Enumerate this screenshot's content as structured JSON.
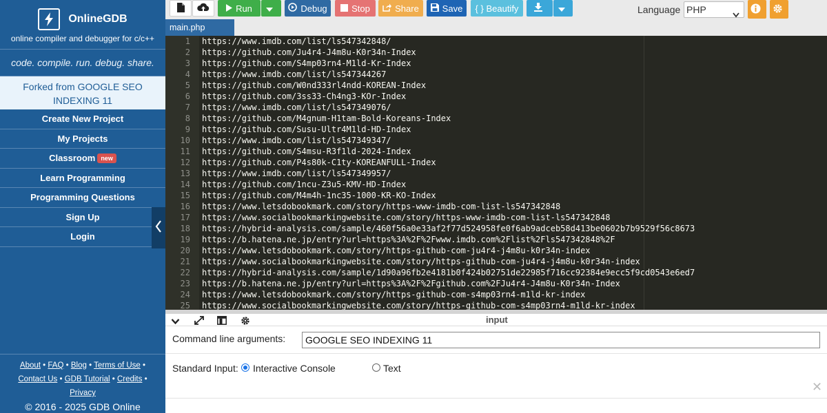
{
  "brand": {
    "name": "OnlineGDB",
    "tagline": "online compiler and debugger for c/c++"
  },
  "motto": "code. compile. run. debug. share.",
  "forked_from": "Forked from GOOGLE SEO INDEXING 11",
  "nav": [
    {
      "label": "Create New Project"
    },
    {
      "label": "My Projects"
    },
    {
      "label": "Classroom",
      "badge": "new"
    },
    {
      "label": "Learn Programming"
    },
    {
      "label": "Programming Questions"
    },
    {
      "label": "Sign Up"
    },
    {
      "label": "Login"
    }
  ],
  "footer": {
    "links": [
      "About",
      "FAQ",
      "Blog",
      "Terms of Use",
      "Contact Us",
      "GDB Tutorial",
      "Credits",
      "Privacy"
    ],
    "copyright": "© 2016 - 2025 GDB Online"
  },
  "toolbar": {
    "run": "Run",
    "debug": "Debug",
    "stop": "Stop",
    "share": "Share",
    "save": "Save",
    "beautify": "{ } Beautify",
    "language_label": "Language",
    "language_value": "PHP"
  },
  "colors": {
    "sidebar": "#1f5d96",
    "run": "#3fae49",
    "debug": "#2f6aa3",
    "stop": "#e57373",
    "share": "#f0ad4e",
    "save": "#1e64b4",
    "beautify": "#5bc0de",
    "download": "#3ba7d9",
    "orange": "#f0a030"
  },
  "editor": {
    "tab": "main.php",
    "lines": [
      "https://www.imdb.com/list/ls547342848/",
      "https://github.com/Ju4r4-J4m8u-K0r34n-Index",
      "https://github.com/S4mp03rn4-M1ld-Kr-Index",
      "https://www.imdb.com/list/ls547344267",
      "https://github.com/W0nd333rl4ndd-KOREAN-Index",
      "https://github.com/3ss33-Ch4ng3-KOr-Index",
      "https://www.imdb.com/list/ls547349076/",
      "https://github.com/M4gnum-H1tam-Bold-Koreans-Index",
      "https://github.com/Susu-Ultr4M1ld-HD-Index",
      "https://www.imdb.com/list/ls547349347/",
      "https://github.com/S4msu-R3f1ld-2024-Index",
      "https://github.com/P4s80k-C1ty-KOREANFULL-Index",
      "https://www.imdb.com/list/ls547349957/",
      "https://github.com/1ncu-Z3u5-KMV-HD-Index",
      "https://github.com/M4m4h-1nc35-1000-KR-KO-Index",
      "https://www.letsdobookmark.com/story/https-www-imdb-com-list-ls547342848",
      "https://www.socialbookmarkingwebsite.com/story/https-www-imdb-com-list-ls547342848",
      "https://hybrid-analysis.com/sample/460f56a0e33af2f77d524958fe0f6ab9adceb58d413be0602b7b9529f56c8673",
      "https://b.hatena.ne.jp/entry?url=https%3A%2F%2Fwww.imdb.com%2Flist%2Fls547342848%2F",
      "https://www.letsdobookmark.com/story/https-github-com-ju4r4-j4m8u-k0r34n-index",
      "https://www.socialbookmarkingwebsite.com/story/https-github-com-ju4r4-j4m8u-k0r34n-index",
      "https://hybrid-analysis.com/sample/1d90a96fb2e4181b0f424b02751de22985f716cc92384e9ecc5f9cd0543e6ed7",
      "https://b.hatena.ne.jp/entry?url=https%3A%2F%2Fgithub.com%2FJu4r4-J4m8u-K0r34n-Index",
      "https://www.letsdobookmark.com/story/https-github-com-s4mp03rn4-m1ld-kr-index",
      "https://www.socialbookmarkingwebsite.com/story/https-github-com-s4mp03rn4-m1ld-kr-index"
    ]
  },
  "io": {
    "title": "input",
    "args_label": "Command line arguments:",
    "args_value": "GOOGLE SEO INDEXING 11",
    "stdin_label": "Standard Input:",
    "opt_console": "Interactive Console",
    "opt_text": "Text",
    "selected": "Interactive Console"
  },
  "icons": [
    "bolt-icon",
    "new-file-icon",
    "upload-icon",
    "play-icon",
    "debug-icon",
    "stop-icon",
    "share-icon",
    "save-icon",
    "download-icon",
    "caret-down-icon",
    "info-icon",
    "gear-icon",
    "chevron-left-icon",
    "chevron-down-icon",
    "expand-icon",
    "layout-icon",
    "close-icon"
  ]
}
